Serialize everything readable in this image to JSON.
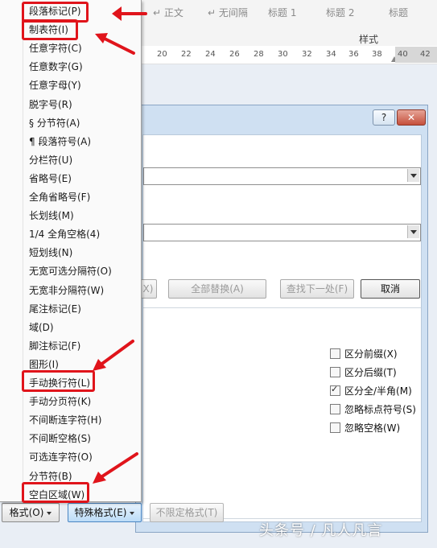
{
  "ribbon": {
    "styles": [
      "↵ 正文",
      "↵ 无间隔",
      "标题 1",
      "标题 2",
      "标题"
    ],
    "group_label": "样式"
  },
  "ruler": {
    "ticks": [
      "20",
      "22",
      "24",
      "26",
      "28",
      "30",
      "32",
      "34",
      "36",
      "38",
      "40",
      "42"
    ]
  },
  "dialog": {
    "help_label": "?",
    "close_label": "✕",
    "buttons": {
      "replace": "X)",
      "replace_all": "全部替换(A)",
      "find_next": "查找下一处(F)",
      "cancel": "取消"
    },
    "options": [
      {
        "label": "区分前缀(X)",
        "checked": false
      },
      {
        "label": "区分后缀(T)",
        "checked": false
      },
      {
        "label": "区分全/半角(M)",
        "checked": true
      },
      {
        "label": "忽略标点符号(S)",
        "checked": false
      },
      {
        "label": "忽略空格(W)",
        "checked": false
      }
    ]
  },
  "bottom_bar": {
    "format": "格式(O)",
    "special": "特殊格式(E)",
    "no_format": "不限定格式(T)"
  },
  "menu": {
    "items": [
      "段落标记(P)",
      "制表符(I)",
      "任意字符(C)",
      "任意数字(G)",
      "任意字母(Y)",
      "脱字号(R)",
      "§ 分节符(A)",
      "¶ 段落符号(A)",
      "分栏符(U)",
      "省略号(E)",
      "全角省略号(F)",
      "长划线(M)",
      "1/4 全角空格(4)",
      "短划线(N)",
      "无宽可选分隔符(O)",
      "无宽非分隔符(W)",
      "尾注标记(E)",
      "域(D)",
      "脚注标记(F)",
      "图形(I)",
      "手动换行符(L)",
      "手动分页符(K)",
      "不间断连字符(H)",
      "不间断空格(S)",
      "可选连字符(O)",
      "分节符(B)",
      "空白区域(W)"
    ]
  },
  "watermark": "头条号 / 凡人凡言",
  "colors": {
    "highlight": "#e0141b",
    "accent": "#4b86c2"
  }
}
